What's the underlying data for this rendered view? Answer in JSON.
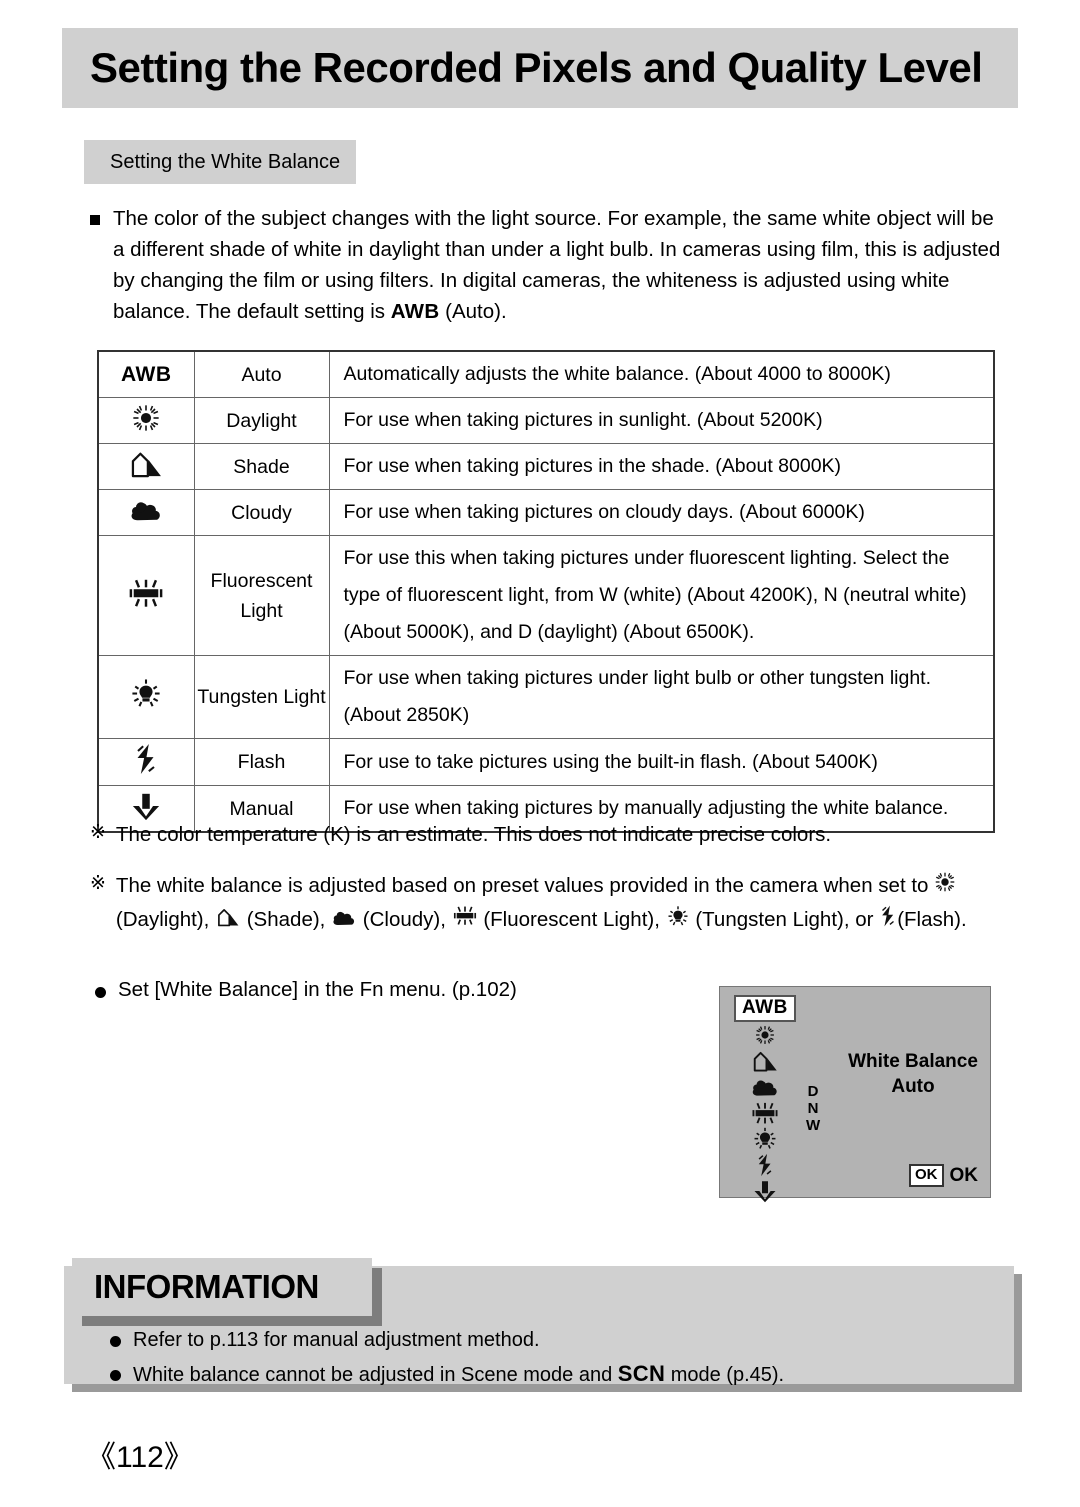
{
  "header": {
    "title": "Setting the Recorded Pixels and Quality Level"
  },
  "section": {
    "tag": "Setting the White Balance"
  },
  "intro": {
    "text_part1": "The color of the subject changes with the light source. For example, the same white object will be a different shade of white in daylight than under a light bulb. In cameras using film, this is adjusted by changing the film or using filters. In digital cameras, the whiteness is adjusted using white balance. The default setting is ",
    "awb_label": "AWB",
    "text_part2": " (Auto)."
  },
  "table": {
    "rows": [
      {
        "icon": "awb-text-icon",
        "icon_label": "AWB",
        "name": "Auto",
        "desc": "Automatically adjusts the white balance. (About 4000 to 8000K)"
      },
      {
        "icon": "sun-icon",
        "name": "Daylight",
        "desc": "For use when taking pictures in sunlight. (About 5200K)"
      },
      {
        "icon": "house-shade-icon",
        "name": "Shade",
        "desc": "For use when taking pictures in the shade. (About 8000K)"
      },
      {
        "icon": "cloud-icon",
        "name": "Cloudy",
        "desc": "For use when taking pictures on cloudy days. (About 6000K)"
      },
      {
        "icon": "fluorescent-tube-icon",
        "name": "Fluorescent\nLight",
        "desc_line1": "For use this when taking pictures under fluorescent lighting. Select the",
        "desc_line2": "type of fluorescent light, from W (white) (About 4200K), N (neutral white)",
        "desc_line3": "(About 5000K), and D (daylight) (About 6500K)."
      },
      {
        "icon": "tungsten-bulb-icon",
        "name": "Tungsten Light",
        "desc_line1": "For use when taking pictures under light bulb or other tungsten light.",
        "desc_line2": "(About 2850K)"
      },
      {
        "icon": "flash-bolt-icon",
        "name": "Flash",
        "desc": "For use to take pictures using the built-in flash. (About 5400K)"
      },
      {
        "icon": "manual-down-icon",
        "name": "Manual",
        "desc": "For use when taking pictures by manually adjusting the white balance."
      }
    ]
  },
  "notes": {
    "mark": "※",
    "note1": "The color temperature (K) is an estimate. This does not indicate precise colors.",
    "note2_line1": "The white balance is adjusted based on preset values provided in the camera when set to ",
    "note2_daylight": "(Daylight), ",
    "note2_shade": "(Shade), ",
    "note2_cloudy": "(Cloudy), ",
    "note2_fluorescent": "(Fluorescent Light), ",
    "note2_tungsten": "(Tungsten Light), or ",
    "note2_flash": "(Flash)."
  },
  "fn_menu": {
    "text": "Set [White Balance] in the Fn menu. (p.102)"
  },
  "lcd": {
    "awb_chip": "AWB",
    "dnw": {
      "d": "D",
      "n": "N",
      "w": "W"
    },
    "title": "White Balance",
    "value": "Auto",
    "ok_chip": "OK",
    "ok_word": "OK"
  },
  "information": {
    "tag": "INFORMATION",
    "item1": "Refer to p.113 for manual adjustment method.",
    "item2_part1": "White balance cannot be adjusted in Scene mode and ",
    "item2_scn": "SCN",
    "item2_part2": " mode (p.45)."
  },
  "page_number": "《112》",
  "colors": {
    "band_gray": "#d0d0d0",
    "lcd_gray": "#b3b3b3",
    "shadow_gray": "#9a9a9a",
    "text_black": "#000000"
  }
}
